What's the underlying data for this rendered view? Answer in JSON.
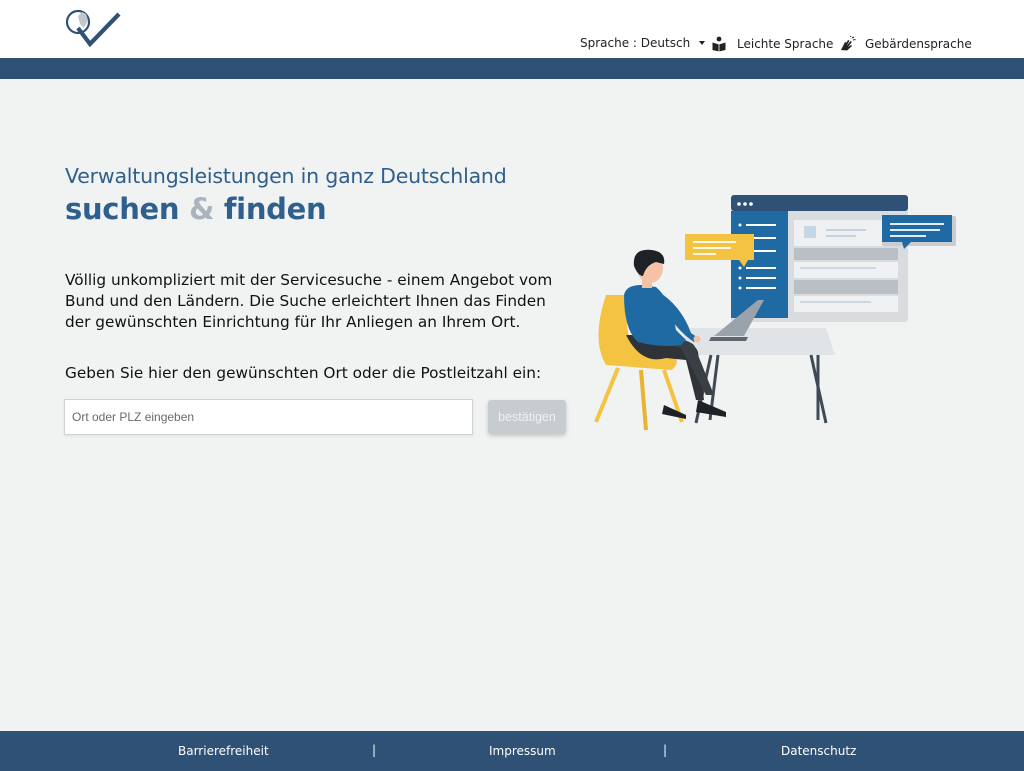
{
  "header": {
    "language_label": "Sprache : Deutsch",
    "easy_language_label": "Leichte Sprache",
    "sign_language_label": "Gebärdensprache"
  },
  "hero": {
    "subtitle": "Verwaltungsleistungen in ganz Deutschland",
    "title_part1": "suchen",
    "title_amp": "&",
    "title_part2": "finden",
    "intro": "Völlig unkompliziert mit der Servicesuche - einem Angebot vom Bund und den Ländern. Die Suche erleichtert Ihnen das Finden der gewünschten Einrichtung für Ihr Anliegen an Ihrem Ort.",
    "prompt": "Geben Sie hier den gewünschten Ort oder die Postleitzahl ein:"
  },
  "search": {
    "placeholder": "Ort oder PLZ eingeben",
    "value": "",
    "submit_label": "bestätigen"
  },
  "footer": {
    "links": [
      "Barrierefreiheit",
      "Impressum",
      "Datenschutz"
    ],
    "separator": "|"
  },
  "colors": {
    "brand_blue": "#2f5175",
    "title_blue": "#2f5f8c",
    "accent_yellow": "#f5c342",
    "chat_blue": "#1f6aa3",
    "background": "#f1f2f2"
  }
}
